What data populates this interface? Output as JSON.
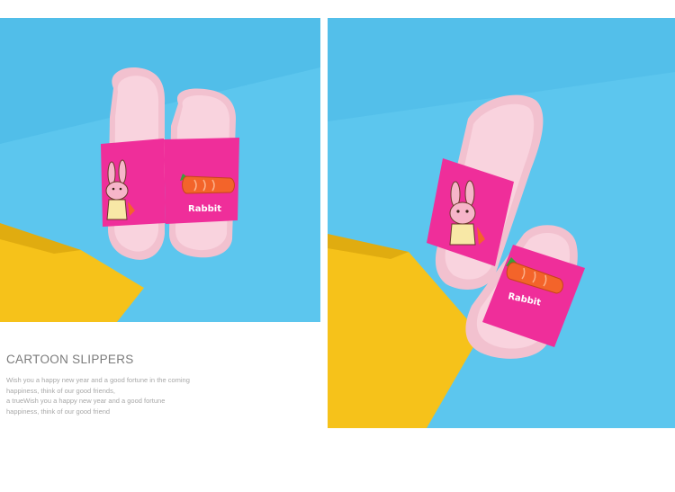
{
  "caption": {
    "title": "CARTOON SLIPPERS",
    "lines": [
      "Wish you a happy new year and a good fortune in the coming",
      "happiness, think of our good friends,",
      "a trueWish you a happy new year and a good fortune",
      "happiness, think of our good friend"
    ]
  },
  "slippers": {
    "label_left": "Rabbit",
    "label_right": "Rabbit"
  },
  "colors": {
    "background_blue": "#5cc6ee",
    "paper_yellow": "#f6c21a",
    "strap_pink": "#ef2e9a",
    "sole_pink": "#f9d3de",
    "carrot_orange": "#f3642a"
  },
  "icons": [
    "rabbit-icon",
    "carrot-icon"
  ]
}
